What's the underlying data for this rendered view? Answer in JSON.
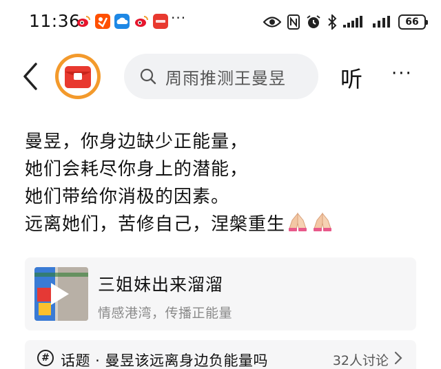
{
  "status_bar": {
    "time": "11:36",
    "more": "···",
    "battery": "66",
    "app_icons": [
      "weibo-icon",
      "taobao-icon",
      "cloud-icon",
      "weibo-icon",
      "app-badge-icon"
    ],
    "system_icons": [
      "eye-icon",
      "nfc-icon",
      "alarm-icon",
      "bluetooth-icon",
      "signal-icon",
      "signal-icon",
      "battery-icon"
    ]
  },
  "header": {
    "search_text": "周雨推测王曼昱",
    "listen_label": "听",
    "menu_label": "···"
  },
  "post": {
    "lines": [
      "曼昱，你身边缺少正能量，",
      "她们会耗尽你身上的潜能，",
      "她们带给你消极的因素。",
      "远离她们，苦修自己，涅槃重生"
    ]
  },
  "video_card": {
    "title": "三姐妹出来溜溜",
    "subtitle": "情感港湾，传播正能量"
  },
  "topic": {
    "label": "话题 · 曼昱该远离身边负能量吗",
    "count": "32人讨论"
  },
  "colors": {
    "avatar_ring": "#f39a2c",
    "avatar_badge": "#e8392f",
    "search_bg": "#f1f2f4",
    "card_bg": "#f6f6f7"
  }
}
